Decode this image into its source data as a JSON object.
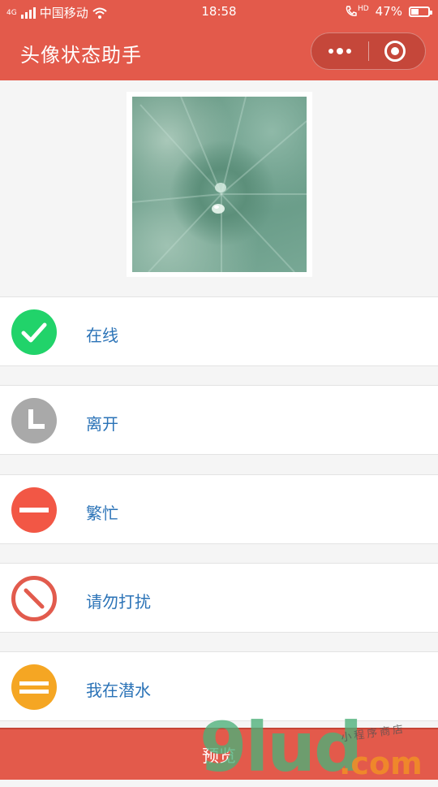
{
  "status_bar": {
    "network": "4G",
    "carrier": "中国移动",
    "time": "18:58",
    "hd": "HD",
    "battery": "47%",
    "battery_level": 0.47
  },
  "nav": {
    "title": "头像状态助手"
  },
  "statuses": [
    {
      "label": "在线",
      "icon": "check-icon",
      "color": "#21d36a"
    },
    {
      "label": "离开",
      "icon": "clock-icon",
      "color": "#a9a9a9"
    },
    {
      "label": "繁忙",
      "icon": "minus-icon",
      "color": "#f25745"
    },
    {
      "label": "请勿打扰",
      "icon": "no-entry-icon",
      "color": "#e25b4d"
    },
    {
      "label": "我在潜水",
      "icon": "equals-icon",
      "color": "#f5a623"
    }
  ],
  "bottom": {
    "preview_label": "预览"
  },
  "watermark": {
    "main": "9lud",
    "suffix": ".com",
    "sub": "小程序商店"
  },
  "colors": {
    "header": "#e35a4b",
    "label": "#2b73b7"
  }
}
